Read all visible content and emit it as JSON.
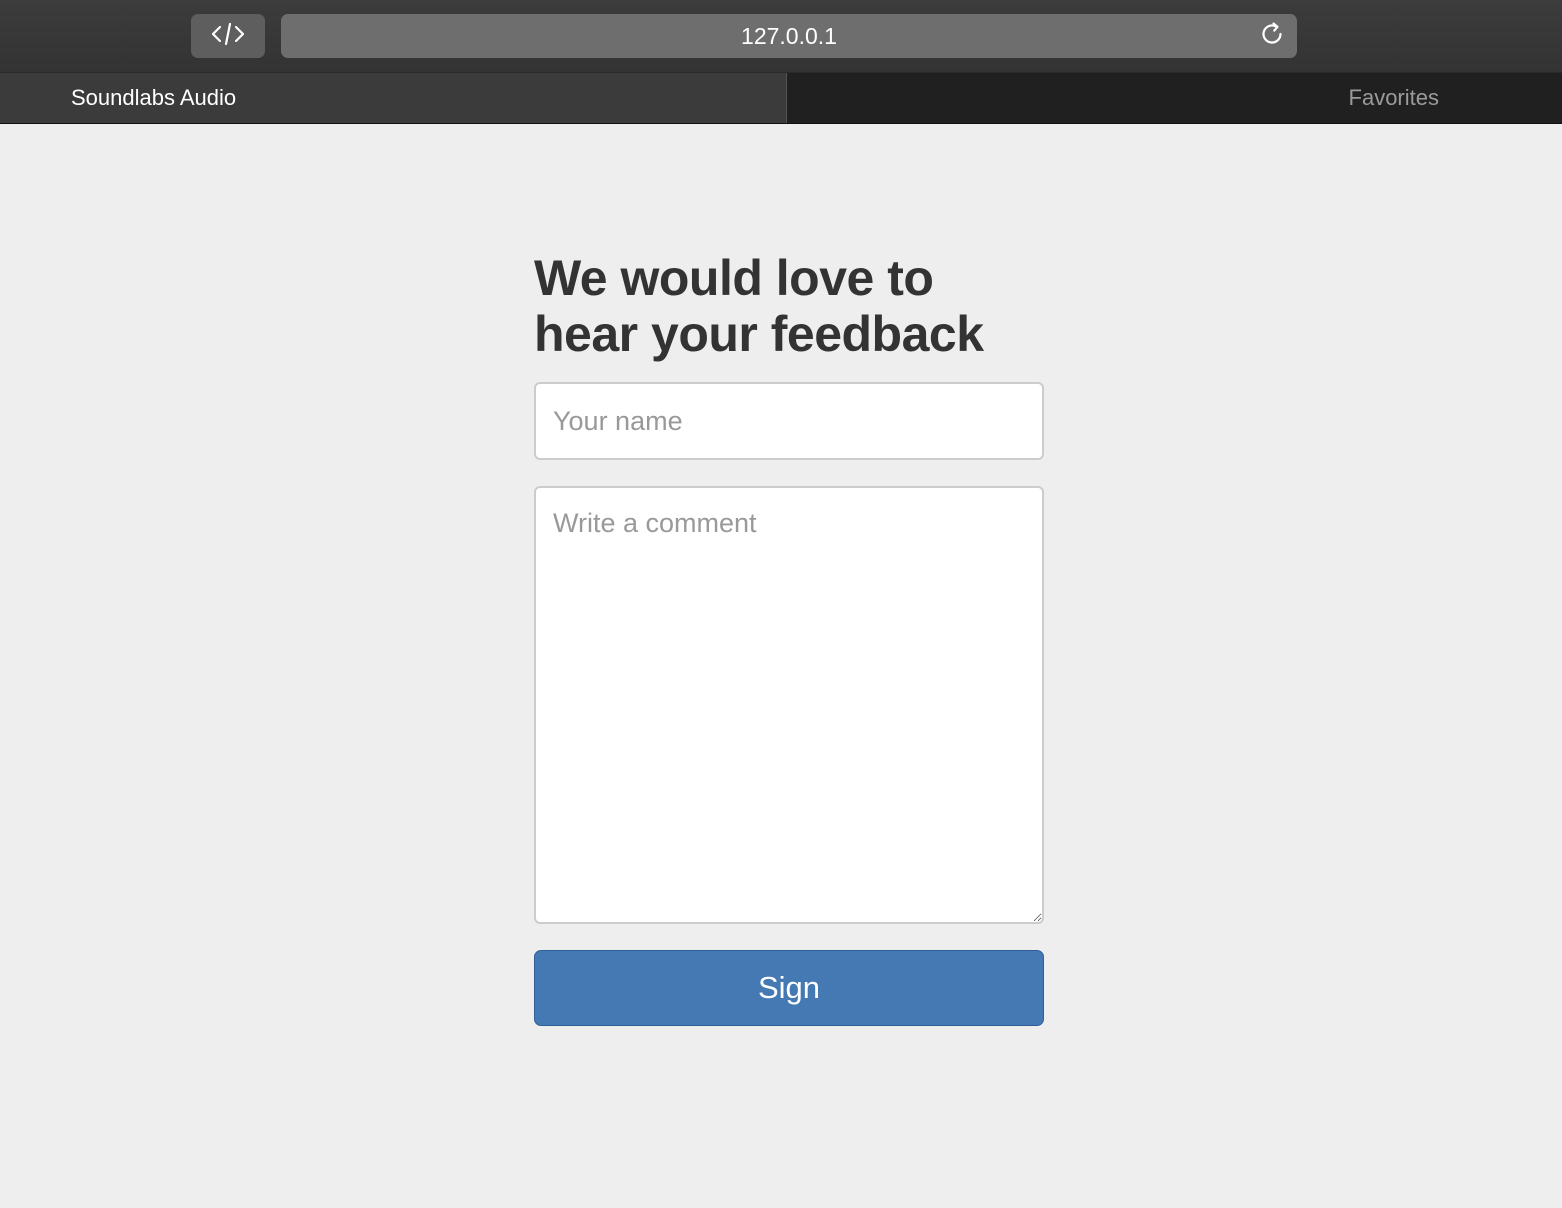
{
  "browser": {
    "address": "127.0.0.1",
    "tabs": [
      {
        "label": "Soundlabs Audio",
        "active": true
      },
      {
        "label": "Favorites",
        "active": false
      }
    ],
    "icons": {
      "dev": "code-brackets-icon",
      "reload": "reload-icon"
    }
  },
  "form": {
    "heading": "We would love to hear your feedback",
    "name_placeholder": "Your name",
    "name_value": "",
    "comment_placeholder": "Write a comment",
    "comment_value": "",
    "submit_label": "Sign"
  },
  "colors": {
    "page_background": "#eeeeee",
    "button_accent": "#4479b4",
    "heading_text": "#333333",
    "chrome_dark": "#202020"
  }
}
